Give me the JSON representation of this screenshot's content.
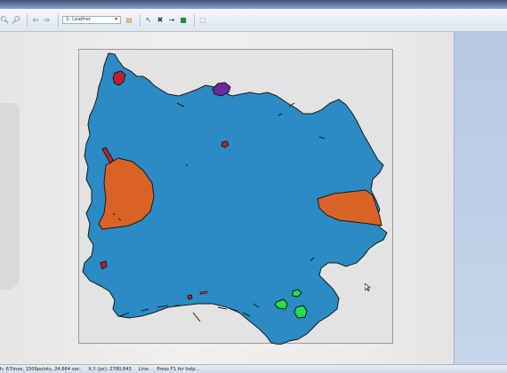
{
  "toolbar": {
    "icons": [
      "zoom-in-icon",
      "zoom-out-icon",
      "arrow-left-icon",
      "arrow-right-icon",
      "folder-icon",
      "pointer-icon",
      "cross-icon",
      "arrow-icon",
      "flag-icon",
      "select-rect-icon"
    ],
    "layer_value": "1: Leather"
  },
  "canvas": {
    "material": "Leather",
    "colors": {
      "hide": "#2b8bc4",
      "defect_orange": "#d96327",
      "defect_red": "#c0202c",
      "defect_purple": "#6a2aa0",
      "defect_green": "#22e04a",
      "outline": "#1a1a1a"
    }
  },
  "status": {
    "objects": "h: 67lines, 1509points, 24.664 sec.",
    "coords": "X,Y (px): 2780,843",
    "mode": "Line.",
    "help": "Press F1 for help..."
  }
}
